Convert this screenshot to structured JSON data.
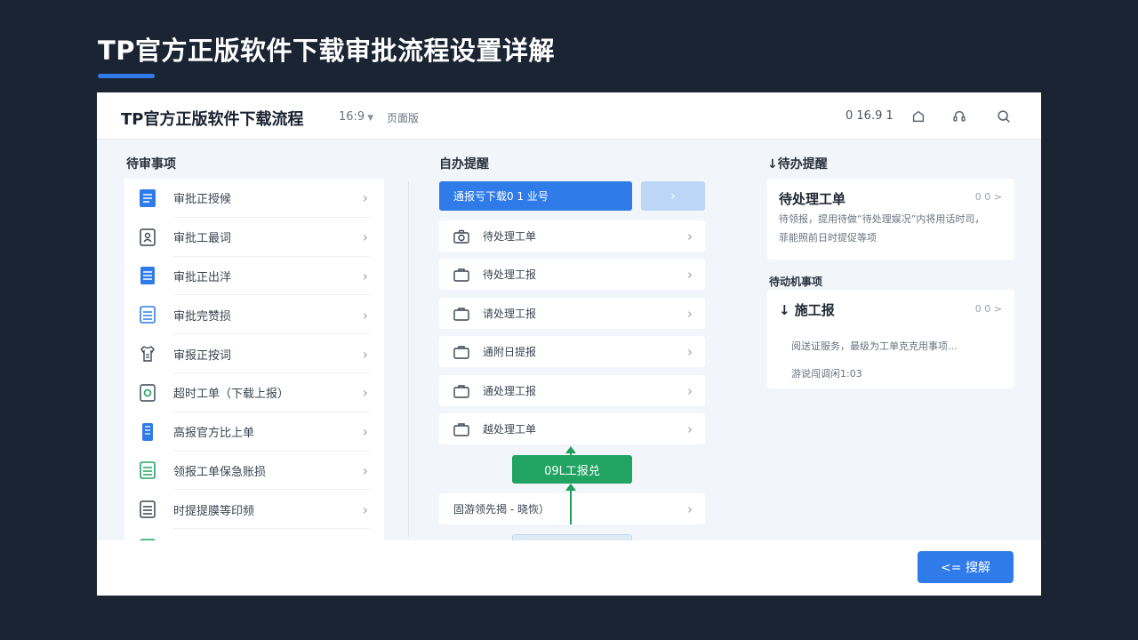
{
  "slide": {
    "title": "TP官方正版软件下载审批流程设置详解"
  },
  "header": {
    "app_title": "TP官方正版软件下载流程",
    "aspect": "16:9",
    "menu_label": "页面版",
    "version": "0 16.9 1"
  },
  "left": {
    "heading": "待审事项",
    "items": [
      {
        "label": "审批正授候",
        "icon": "doc-blue-icon"
      },
      {
        "label": "审批工最词",
        "icon": "id-card-icon"
      },
      {
        "label": "审批正出洋",
        "icon": "doc-blue-icon"
      },
      {
        "label": "审批完赞损",
        "icon": "doc-outline-blue-icon"
      },
      {
        "label": "审报正按词",
        "icon": "shirt-icon"
      },
      {
        "label": "超时工单（下载上报）",
        "icon": "doc-green-icon"
      },
      {
        "label": "高报官方比上单",
        "icon": "phone-blue-icon"
      },
      {
        "label": "领报工单保急账损",
        "icon": "doc-green-icon"
      },
      {
        "label": "时提提膜等印频",
        "icon": "doc-outline-icon"
      }
    ]
  },
  "middle": {
    "heading": "自办提醒",
    "active_label": "通报亏下载0 1 业号",
    "items": [
      {
        "label": "待处理工单",
        "icon": "camera-icon"
      },
      {
        "label": "待处理工报",
        "icon": "briefcase-icon"
      },
      {
        "label": "请处理工报",
        "icon": "briefcase-icon"
      },
      {
        "label": "通附日提报",
        "icon": "briefcase-icon"
      },
      {
        "label": "通处理工报",
        "icon": "briefcase-icon"
      },
      {
        "label": "越处理工单",
        "icon": "briefcase-icon"
      }
    ],
    "flow_node": "09L工报兑",
    "bottom_item": "固游领先揭 - 晓恢）"
  },
  "right": {
    "heading": "待办提醒",
    "card1": {
      "title": "待处理工单",
      "meta": "0 0 >",
      "line1": "待领报，提用待做“待处理娱况”内将用话时司，",
      "line2": "菲能照前日时提促等项"
    },
    "sub_heading": "待动机事项",
    "card2": {
      "title": "施工报",
      "meta": "0 0 >",
      "line1": "阅送证服务，最级为工单克克用事项...",
      "line2": "游说闯调闲1:03"
    }
  },
  "footer": {
    "cta_label": "<= 搜解"
  },
  "colors": {
    "accent": "#2f7bea",
    "success": "#21a361",
    "background": "#1b2433"
  }
}
